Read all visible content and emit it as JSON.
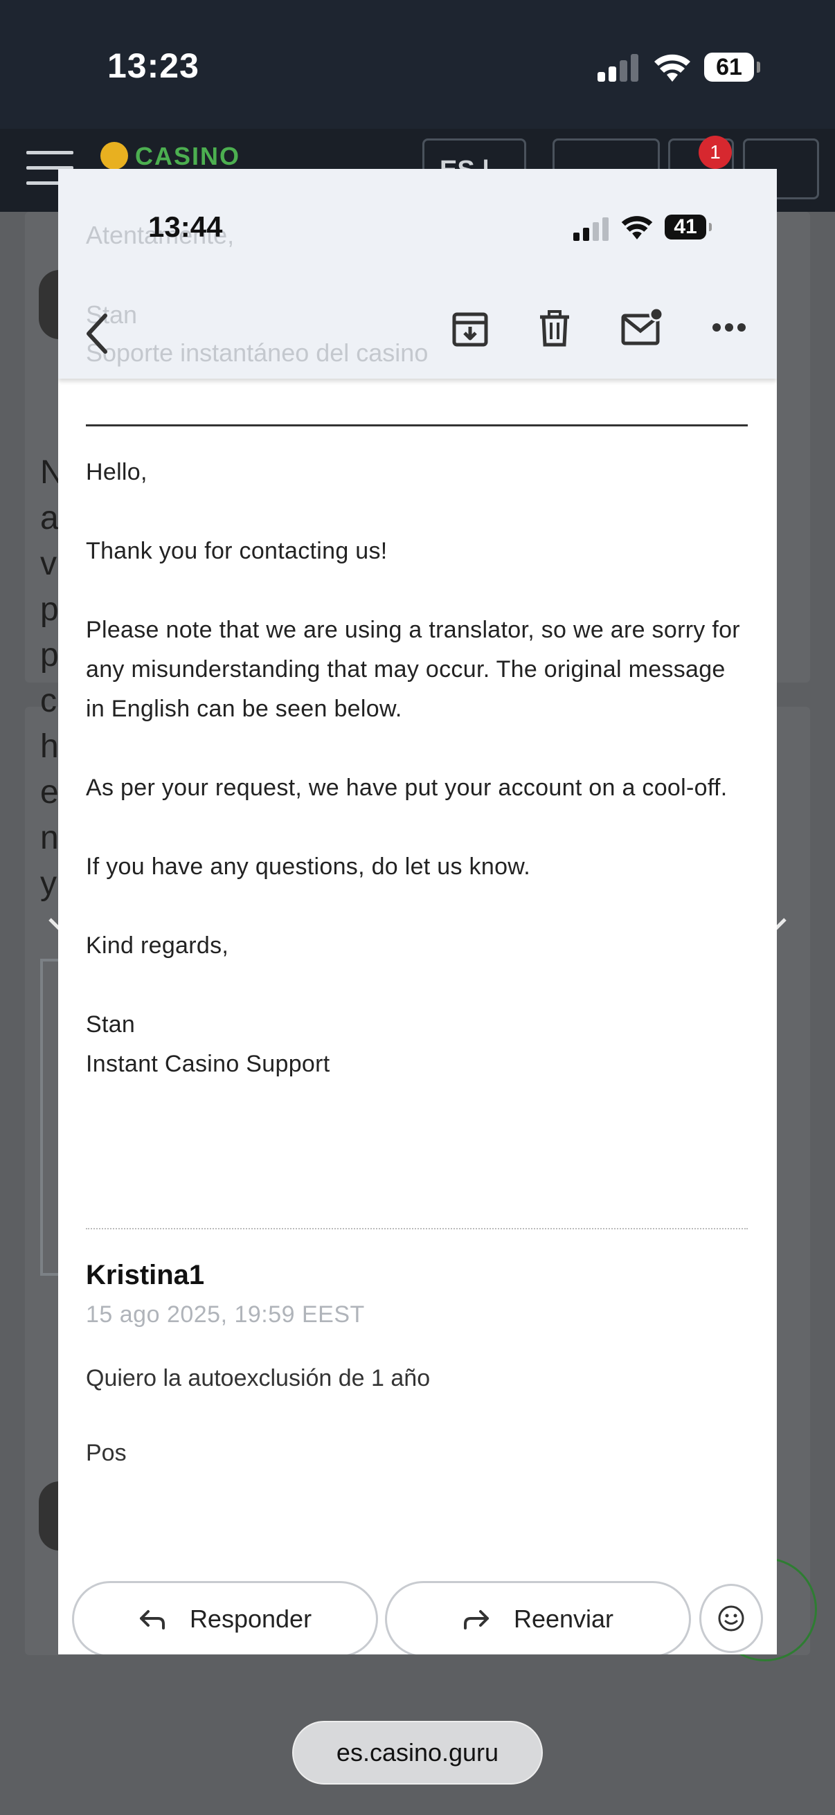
{
  "outer_status": {
    "time": "13:23",
    "battery": "61"
  },
  "site_header": {
    "logo_text": "CASINO",
    "lang_label": "ES |",
    "notification_count": "1"
  },
  "email_screenshot": {
    "status": {
      "time": "13:44",
      "battery": "41"
    },
    "ghost_lines": [
      "Atentamente,",
      "Stan",
      "Soporte instantáneo del casino"
    ],
    "body_paragraphs": [
      "Hello,",
      "Thank you for contacting us!",
      "Please note that we are using a translator, so we are sorry for any misunderstanding that may occur. The original message in English can be seen below.",
      "As per your request, we have put your account on a cool-off.",
      "If you have any questions, do let us know.",
      "Kind regards,"
    ],
    "signature_name": "Stan",
    "signature_team": "Instant Casino Support",
    "sender": {
      "name": "Kristina1",
      "date": "15 ago 2025, 19:59 EEST",
      "message_line1": "Quiero la autoexclusión de 1 año",
      "message_line2": "Pos"
    },
    "actions": {
      "reply_label": "Responder",
      "forward_label": "Reenviar"
    }
  },
  "background_page": {
    "visible_letters": [
      "N",
      "a",
      "v",
      "p",
      "p",
      "c",
      "h",
      "e",
      "n",
      "y"
    ]
  },
  "url_bar": {
    "domain": "es.casino.guru"
  },
  "colors": {
    "status_bar": "#1e2530",
    "site_header": "#1a1f27",
    "badge_red": "#d7282f",
    "email_header": "#eef1f6",
    "casino_green": "#4caf50"
  }
}
